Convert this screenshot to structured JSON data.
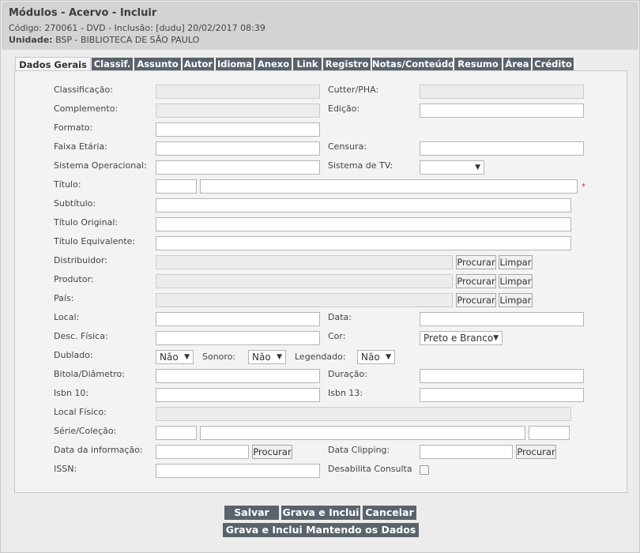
{
  "header": {
    "title": "Módulos - Acervo - Incluir",
    "info": "Código: 270061 - DVD - Inclusão: [dudu] 20/02/2017 08:39",
    "unidade_label": "Unidade:",
    "unidade_value": "BSP - BIBLIOTECA DE SÃO PAULO"
  },
  "tabs": [
    "Dados Gerais",
    "Classif.",
    "Assunto",
    "Autor",
    "Idioma",
    "Anexo",
    "Link",
    "Registro",
    "Notas/Conteúdo",
    "Resumo",
    "Área",
    "Crédito"
  ],
  "form": {
    "classificacao": "Classificação:",
    "cutter": "Cutter/PHA:",
    "complemento": "Complemento:",
    "edicao": "Edição:",
    "formato": "Formato:",
    "faixa_etaria": "Faixa Etária:",
    "censura": "Censura:",
    "sistema_operacional": "Sistema Operacional:",
    "sistema_tv": "Sistema de TV:",
    "titulo": "Título:",
    "required_mark": "*",
    "subtitulo": "Subtítulo:",
    "titulo_original": "Título Original:",
    "titulo_equivalente": "Título Equivalente:",
    "distribuidor": "Distribuidor:",
    "produtor": "Produtor:",
    "pais": "País:",
    "local": "Local:",
    "data": "Data:",
    "desc_fisica": "Desc. Física:",
    "cor": "Cor:",
    "cor_value": "Preto e Branco",
    "dublado": "Dublado:",
    "dublado_value": "Não",
    "sonoro": "Sonoro:",
    "sonoro_value": "Não",
    "legendado": "Legendado:",
    "legendado_value": "Não",
    "bitola": "Bitola/Diâmetro:",
    "duracao": "Duração:",
    "isbn10": "Isbn 10:",
    "isbn13": "Isbn 13:",
    "local_fisico": "Local Físico:",
    "serie": "Série/Coleção:",
    "data_informacao": "Data da informação:",
    "data_clipping": "Data Clipping:",
    "issn": "ISSN:",
    "desabilita": "Desabilita Consulta"
  },
  "buttons": {
    "procurar": "Procurar",
    "limpar": "Limpar",
    "salvar": "Salvar",
    "grava_inclui": "Grava e Inclui",
    "cancelar": "Cancelar",
    "grava_mantendo": "Grava e Inclui Mantendo os Dados"
  },
  "icons": {
    "dropdown": "▼"
  }
}
